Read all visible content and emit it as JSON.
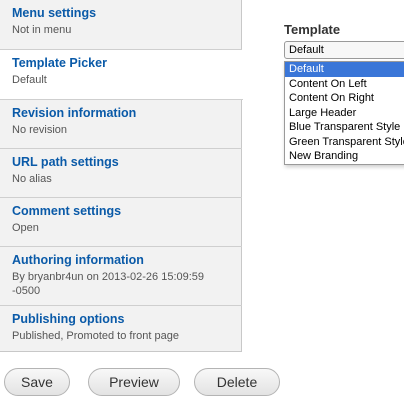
{
  "tabs": [
    {
      "title": "Menu settings",
      "summary": "Not in menu"
    },
    {
      "title": "Template Picker",
      "summary": "Default"
    },
    {
      "title": "Revision information",
      "summary": "No revision"
    },
    {
      "title": "URL path settings",
      "summary": "No alias"
    },
    {
      "title": "Comment settings",
      "summary": "Open"
    },
    {
      "title": "Authoring information",
      "summary_line1": "By bryanbr4un on 2013-02-26 15:09:59",
      "summary_line2": "-0500"
    },
    {
      "title": "Publishing options",
      "summary": "Published, Promoted to front page"
    }
  ],
  "template": {
    "label": "Template",
    "selected": "Default",
    "options": [
      "Default",
      "Content On Left",
      "Content On Right",
      "Large Header",
      "Blue Transparent Style",
      "Green Transparent Style",
      "New Branding"
    ]
  },
  "buttons": {
    "save": "Save",
    "preview": "Preview",
    "delete": "Delete"
  }
}
